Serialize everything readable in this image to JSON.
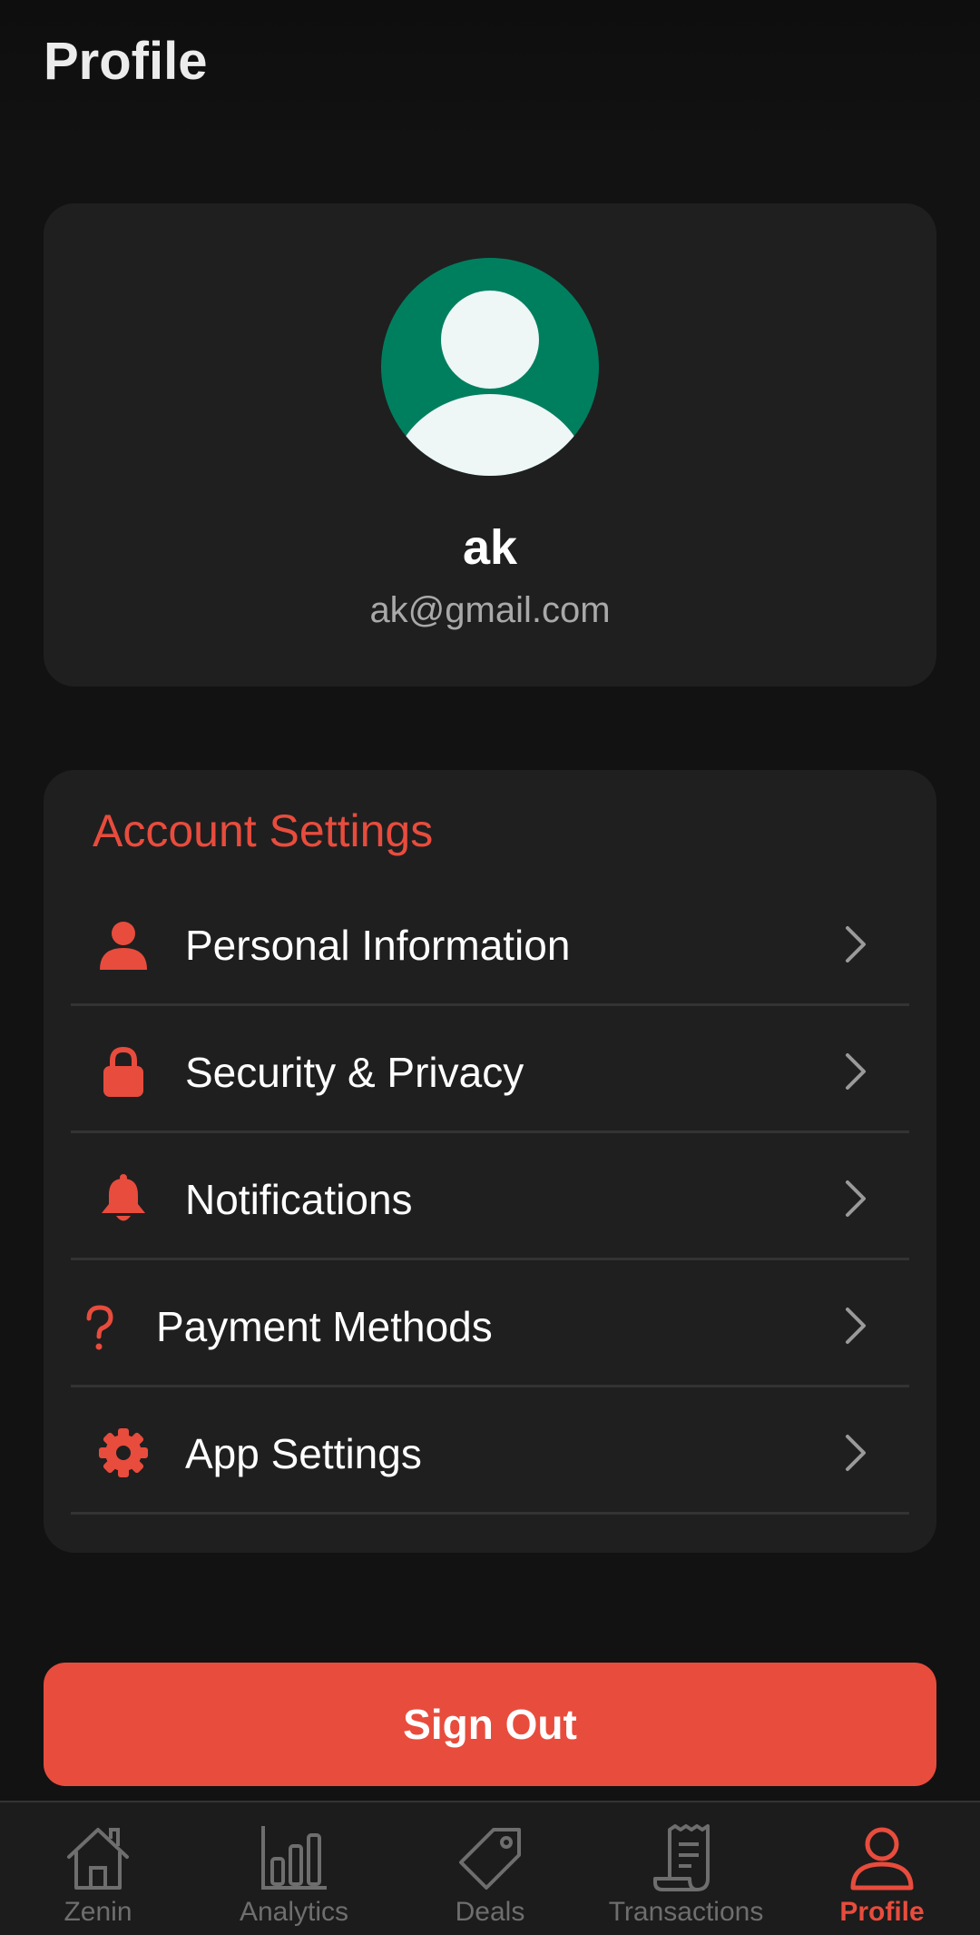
{
  "header": {
    "title": "Profile"
  },
  "profile": {
    "name": "ak",
    "email": "ak@gmail.com",
    "avatar_icon": "default-user-avatar-icon",
    "avatar_bg": "#007f5f"
  },
  "account_settings": {
    "title": "Account Settings",
    "items": [
      {
        "label": "Personal Information",
        "icon": "person-icon"
      },
      {
        "label": "Security & Privacy",
        "icon": "lock-icon"
      },
      {
        "label": "Notifications",
        "icon": "bell-icon"
      },
      {
        "label": "Payment Methods",
        "icon": "question-mark-icon"
      },
      {
        "label": "App Settings",
        "icon": "gear-icon"
      }
    ]
  },
  "sign_out": {
    "label": "Sign Out"
  },
  "bottom_nav": {
    "items": [
      {
        "label": "Zenin",
        "icon": "home-icon",
        "active": false
      },
      {
        "label": "Analytics",
        "icon": "bar-chart-icon",
        "active": false
      },
      {
        "label": "Deals",
        "icon": "tag-icon",
        "active": false
      },
      {
        "label": "Transactions",
        "icon": "receipt-icon",
        "active": false
      },
      {
        "label": "Profile",
        "icon": "person-outline-icon",
        "active": true
      }
    ]
  },
  "colors": {
    "accent": "#e84c3d",
    "background": "#121212",
    "card": "#1f1f1f",
    "muted_text": "#a9a9a9",
    "nav_inactive": "#6e6e6e"
  }
}
